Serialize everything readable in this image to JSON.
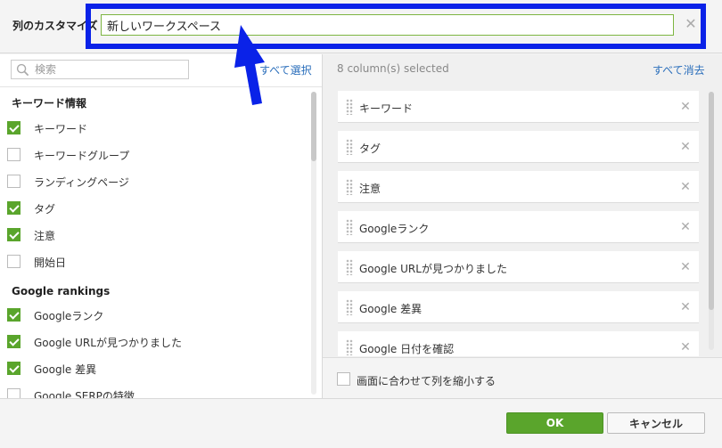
{
  "header": {
    "title": "列のカスタマイズ",
    "name_value": "新しいワークスペース",
    "close_symbol": "✕"
  },
  "left": {
    "search_placeholder": "検索",
    "select_all": "すべて選択",
    "groups": [
      {
        "title": "キーワード情報",
        "items": [
          {
            "label": "キーワード",
            "checked": true
          },
          {
            "label": "キーワードグループ",
            "checked": false
          },
          {
            "label": "ランディングページ",
            "checked": false
          },
          {
            "label": "タグ",
            "checked": true
          },
          {
            "label": "注意",
            "checked": true
          },
          {
            "label": "開始日",
            "checked": false
          }
        ]
      },
      {
        "title": "Google rankings",
        "items": [
          {
            "label": "Googleランク",
            "checked": true
          },
          {
            "label": "Google URLが見つかりました",
            "checked": true
          },
          {
            "label": "Google 差異",
            "checked": true
          },
          {
            "label": "Google SERPの特徴",
            "checked": false
          }
        ]
      }
    ]
  },
  "right": {
    "selected_count": "8 column(s) selected",
    "clear_all": "すべて消去",
    "items": [
      {
        "label": "キーワード"
      },
      {
        "label": "タグ"
      },
      {
        "label": "注意"
      },
      {
        "label": "Googleランク"
      },
      {
        "label": "Google URLが見つかりました"
      },
      {
        "label": "Google 差異"
      },
      {
        "label": "Google 日付を確認"
      }
    ],
    "remove_symbol": "✕",
    "shrink_label": "画面に合わせて列を縮小する"
  },
  "footer": {
    "ok": "OK",
    "cancel": "キャンセル"
  },
  "colors": {
    "accent_green": "#5aa52c",
    "highlight_blue": "#0a22e8",
    "link_blue": "#2a6ebb"
  }
}
